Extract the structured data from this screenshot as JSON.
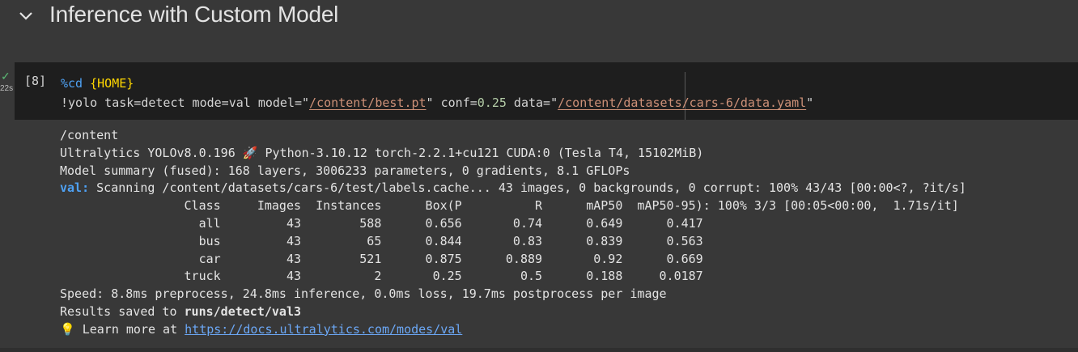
{
  "section": {
    "title": "Inference with Custom Model"
  },
  "cell": {
    "status_time": "22s",
    "exec_count": "[8]",
    "code": {
      "line1": {
        "magic": "%cd",
        "arg": "{HOME}"
      },
      "line2": {
        "p1": "!yolo task=detect mode=val model=\"",
        "model": "/content/best.pt",
        "p2": "\" conf=",
        "conf": "0.25",
        "p3": " data=\"",
        "data": "/content/datasets/cars-6/data.yaml",
        "p4": "\""
      }
    }
  },
  "output": {
    "cwd": "/content",
    "version": "Ultralytics YOLOv8.0.196 🚀 Python-3.10.12 torch-2.2.1+cu121 CUDA:0 (Tesla T4, 15102MiB)",
    "summary": "Model summary (fused): 168 layers, 3006233 parameters, 0 gradients, 8.1 GFLOPs",
    "val_label": "val:",
    "val_text": " Scanning /content/datasets/cars-6/test/labels.cache... 43 images, 0 backgrounds, 0 corrupt: 100% 43/43 [00:00<?, ?it/s]",
    "table_header": "                 Class     Images  Instances      Box(P          R      mAP50  mAP50-95): 100% 3/3 [00:05<00:00,  1.71s/it]",
    "rows": [
      "                   all         43        588      0.656       0.74      0.649      0.417",
      "                   bus         43         65      0.844       0.83      0.839      0.563",
      "                   car         43        521      0.875      0.889       0.92      0.669",
      "                 truck         43          2       0.25        0.5      0.188     0.0187"
    ],
    "speed": "Speed: 8.8ms preprocess, 24.8ms inference, 0.0ms loss, 19.7ms postprocess per image",
    "saved_prefix": "Results saved to ",
    "saved_path": "runs/detect/val3",
    "learn_emoji": "💡",
    "learn_prefix": " Learn more at ",
    "learn_link": "https://docs.ultralytics.com/modes/val"
  }
}
